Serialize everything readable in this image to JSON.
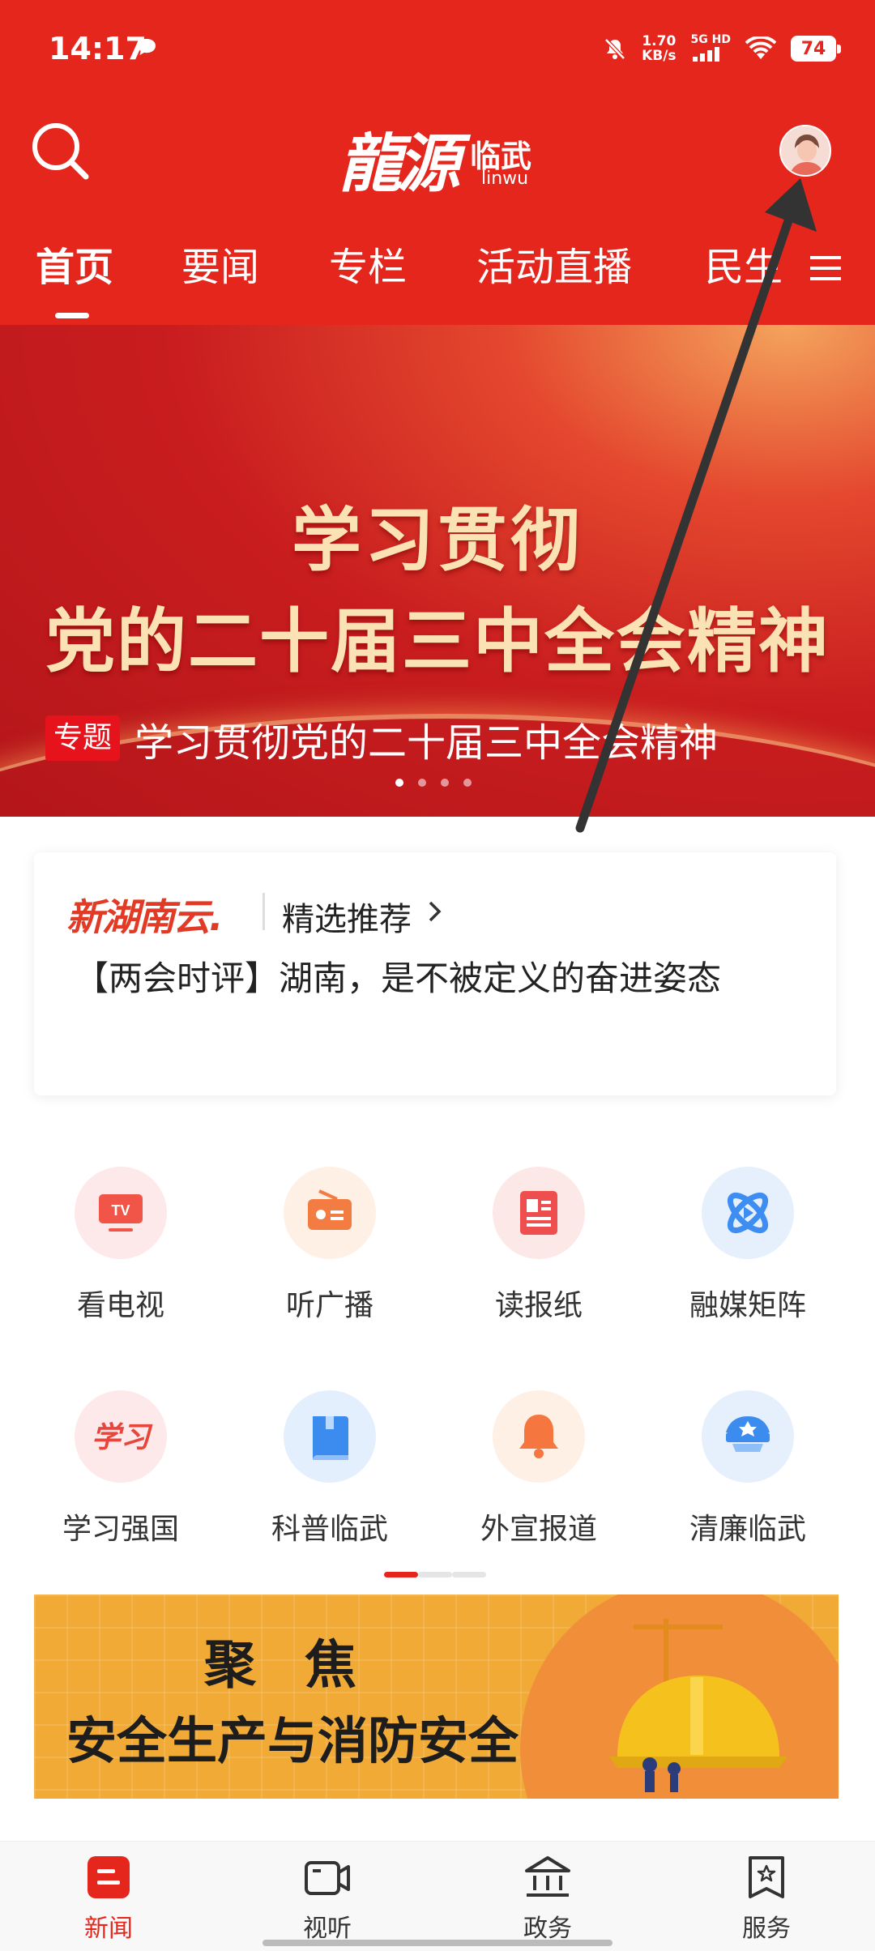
{
  "status_bar": {
    "time": "14:17",
    "net_speed": "1.70",
    "net_unit": "KB/s",
    "signal": "5G HD",
    "battery": "74"
  },
  "header": {
    "logo_main": "龍源",
    "logo_city": "临武",
    "logo_pinyin": "linwu"
  },
  "tabs": [
    "首页",
    "要闻",
    "专栏",
    "活动直播",
    "民生"
  ],
  "banner": {
    "line1": "学习贯彻",
    "line2": "党的二十届三中全会精神",
    "tag": "专题",
    "caption": "学习贯彻党的二十届三中全会精神",
    "slides": 4,
    "active_slide": 0
  },
  "recommend": {
    "brand": "新湖南云.",
    "label": "精选推荐",
    "headline": "【两会时评】湖南，是不被定义的奋进姿态"
  },
  "grid": [
    {
      "label": "看电视",
      "icon": "tv-icon"
    },
    {
      "label": "听广播",
      "icon": "radio-icon"
    },
    {
      "label": "读报纸",
      "icon": "newspaper-icon"
    },
    {
      "label": "融媒矩阵",
      "icon": "media-matrix-icon"
    },
    {
      "label": "学习强国",
      "icon": "xuexi-icon"
    },
    {
      "label": "科普临武",
      "icon": "book-icon"
    },
    {
      "label": "外宣报道",
      "icon": "bell-icon"
    },
    {
      "label": "清廉临武",
      "icon": "police-cap-icon"
    }
  ],
  "promo": {
    "line1": "聚焦",
    "line2": "安全生产与消防安全"
  },
  "bottom_nav": [
    {
      "label": "新闻",
      "icon": "news-icon",
      "active": true
    },
    {
      "label": "视听",
      "icon": "video-icon",
      "active": false
    },
    {
      "label": "政务",
      "icon": "government-icon",
      "active": false
    },
    {
      "label": "服务",
      "icon": "service-icon",
      "active": false
    }
  ],
  "colors": {
    "brand_red": "#e5261d",
    "banner_text": "#fbe2b4",
    "promo_bg": "#f0aa35"
  }
}
